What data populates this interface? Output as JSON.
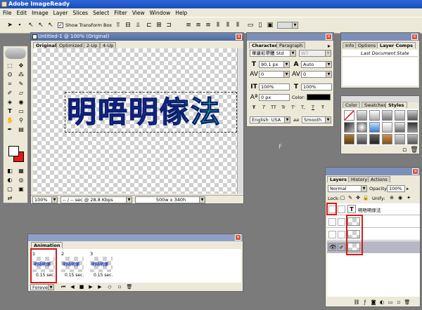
{
  "app": {
    "title": "Adobe ImageReady"
  },
  "menu": [
    "File",
    "Edit",
    "Image",
    "Layer",
    "Slices",
    "Select",
    "Filter",
    "View",
    "Window",
    "Help"
  ],
  "options": {
    "show_transform_box": "Show Transform Box"
  },
  "doc": {
    "title": "Untitled-1 @ 100% (Original)",
    "tabs": [
      "Original",
      "Optimized",
      "2-Up",
      "4-Up"
    ],
    "canvas_text": "明唔明傢法",
    "zoom": "100%",
    "speed": "-- / -- sec @ 28.8 Kbps",
    "size": "500w x 340h"
  },
  "character": {
    "tabs": [
      "Character",
      "Paragraph"
    ],
    "font": "華康彩帶體 Std",
    "style": "W7",
    "size": "90.1 px",
    "leading": "Auto",
    "kerning": "0",
    "tracking": "0",
    "vscale": "100%",
    "hscale": "100%",
    "baseline": "0 px",
    "color_label": "Color:",
    "style_buttons": [
      "T",
      "T",
      "TT",
      "Tr",
      "T'",
      "T,",
      "T",
      "Ŧ"
    ],
    "lang": "English: USA",
    "aa_label": "aa",
    "aa": "Smooth"
  },
  "info": {
    "tabs": [
      "Info",
      "Options",
      "Layer Comps"
    ],
    "row": "Last Document State"
  },
  "styles": {
    "tabs": [
      "Color",
      "Swatches",
      "Styles"
    ]
  },
  "layers": {
    "tabs": [
      "Layers",
      "History",
      "Actions"
    ],
    "blend": "Normal",
    "opacity_label": "Opacity:",
    "opacity": "100%",
    "lock_label": "Lock:",
    "unify_label": "Unify:",
    "text_layer": "明唔明傢法",
    "text_glyph": "T"
  },
  "animation": {
    "title": "Animation",
    "frames": [
      {
        "n": "1",
        "delay": "0.15 sec."
      },
      {
        "n": "2",
        "delay": "0.15 sec."
      },
      {
        "n": "3",
        "delay": "0.15 sec."
      }
    ],
    "loop": "Forever",
    "frame_thumb_text": "明唔明傢"
  },
  "canvas_marker": "F",
  "colors": {
    "accent_red": "#d21a1a",
    "fg": "#ffffff",
    "bg": "#e81818",
    "text_blue": "#1c3aa8",
    "text_green": "#1fd28c"
  }
}
